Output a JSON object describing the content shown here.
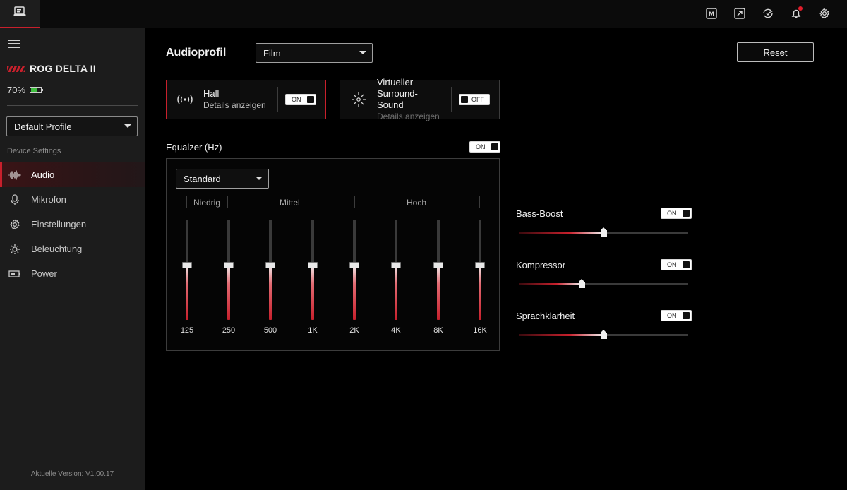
{
  "topbar": {
    "app_icon": "device-app-icon",
    "icons": [
      "macro-icon",
      "expand-icon",
      "sync-icon",
      "notification-bell-icon",
      "settings-gear-icon"
    ]
  },
  "sidebar": {
    "device_name": "ROG DELTA II",
    "battery": "70%",
    "battery_level": 0.7,
    "profile": "Default Profile",
    "section_label": "Device Settings",
    "items": [
      {
        "label": "Audio",
        "icon": "audio-wave-icon",
        "active": true
      },
      {
        "label": "Mikrofon",
        "icon": "microphone-icon",
        "active": false
      },
      {
        "label": "Einstellungen",
        "icon": "gear-icon",
        "active": false
      },
      {
        "label": "Beleuchtung",
        "icon": "lighting-icon",
        "active": false
      },
      {
        "label": "Power",
        "icon": "battery-icon",
        "active": false
      }
    ],
    "version": "Aktuelle Version: V1.00.17"
  },
  "main": {
    "title": "Audioprofil",
    "profile_value": "Film",
    "reset_label": "Reset",
    "cards": {
      "hall": {
        "title": "Hall",
        "subtitle": "Details anzeigen",
        "toggle": "ON"
      },
      "surround": {
        "title_line1": "Virtueller Surround-",
        "title_line2": "Sound",
        "subtitle": "Details anzeigen",
        "toggle": "OFF"
      }
    },
    "equalizer": {
      "label": "Equalzer (Hz)",
      "toggle": "ON",
      "preset": "Standard",
      "groups": {
        "low": "Niedrig",
        "mid": "Mittel",
        "high": "Hoch"
      },
      "bands": [
        {
          "label": "125",
          "level": 0.55
        },
        {
          "label": "250",
          "level": 0.55
        },
        {
          "label": "500",
          "level": 0.55
        },
        {
          "label": "1K",
          "level": 0.55
        },
        {
          "label": "2K",
          "level": 0.55
        },
        {
          "label": "4K",
          "level": 0.55
        },
        {
          "label": "8K",
          "level": 0.55
        },
        {
          "label": "16K",
          "level": 0.55
        }
      ]
    },
    "effects": [
      {
        "name": "Bass-Boost",
        "toggle": "ON",
        "value": 0.5
      },
      {
        "name": "Kompressor",
        "toggle": "ON",
        "value": 0.37
      },
      {
        "name": "Sprachklarheit",
        "toggle": "ON",
        "value": 0.5
      }
    ]
  },
  "colors": {
    "accent": "#c8202c",
    "background": "#000000",
    "sidebar": "#1c1c1c"
  }
}
